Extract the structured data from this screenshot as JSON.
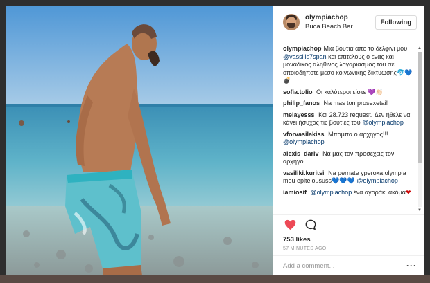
{
  "post": {
    "username": "olympiachop",
    "location": "Buca Beach Bar",
    "follow_label": "Following"
  },
  "caption": {
    "user": "olympiachop",
    "text_1": "Μια βουτια απο το δελφινι μου ",
    "mention": "@vassilis7span",
    "text_2": " και επιτελους ο ενας και μοναδικος αληθινος λογαριασμος του σε οποιοδηποτε μεσο κοινωνικης δικτυωσης",
    "emoji": "🐬💙💣"
  },
  "comments": [
    {
      "user": "sofia.tolio",
      "text": "Οι καλύτεροι είστε",
      "emoji": "💜👏🏻"
    },
    {
      "user": "philip_fanos",
      "text": "Na mas ton prosexetai!"
    },
    {
      "user": "melayesss",
      "text": "Και 28.723 request. Δεν ήθελε να κάνει ήσυχος τις βουτιές του",
      "mention": "@olympiachop"
    },
    {
      "user": "vforvasilakiss",
      "text": "Μπομπα ο αρχηγος!!!",
      "mention": "@olympiachop"
    },
    {
      "user": "alexis_dariv",
      "text": "Να μας τον προσεχεις τον αρχηγο"
    },
    {
      "user": "vasiliki.kuritsi",
      "text": "Na pernate yperoxa olympia mou epiteloususs",
      "emoji": "💙💙💙",
      "mention": "@olympiachop"
    },
    {
      "user": "iamiosif",
      "mention": "@olympiachop",
      "text": "ένα αγοράκι ακόμα",
      "emoji": "❤"
    }
  ],
  "likes": "753 likes",
  "timestamp": "57 MINUTES AGO",
  "add_comment_placeholder": "Add a comment...",
  "more_label": "···",
  "icons": [
    "heart-icon",
    "comment-icon",
    "more-icon"
  ],
  "colors": {
    "like_red": "#ed4956",
    "link": "#003569",
    "muted": "#999999"
  }
}
